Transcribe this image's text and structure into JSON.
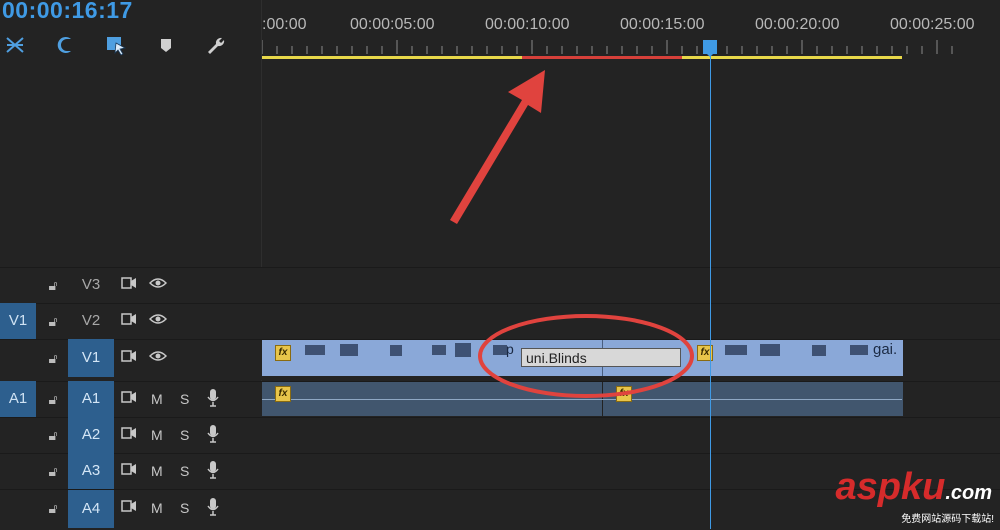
{
  "timecode": "00:00:16:17",
  "toolbar": {
    "icons": [
      "ripple-snap-icon",
      "snap-magnet-icon",
      "linked-selection-icon",
      "add-marker-icon",
      "settings-wrench-icon"
    ]
  },
  "ruler": {
    "labels": [
      ":00:00",
      "00:00:05:00",
      "00:00:10:00",
      "00:00:15:00",
      "00:00:20:00",
      "00:00:25:00"
    ],
    "work_area_color": "#e8d84a",
    "render_bar_color": "#d6403a"
  },
  "tracks": {
    "v3": {
      "label": "V3",
      "source": ""
    },
    "v2": {
      "label": "V2",
      "source": "V1"
    },
    "v1": {
      "label": "V1",
      "source": ""
    },
    "a1": {
      "label": "A1",
      "source": "A1",
      "m": "M",
      "s": "S"
    },
    "a2": {
      "label": "A2",
      "source": "",
      "m": "M",
      "s": "S"
    },
    "a3": {
      "label": "A3",
      "source": "",
      "m": "M",
      "s": "S"
    },
    "a4": {
      "label": "A4",
      "source": "",
      "m": "M",
      "s": "S"
    }
  },
  "clips": {
    "fx_label": "fx",
    "transition_label": "uni.Blinds",
    "clip_name_tail": "gai.",
    "clip_name_mid": "p"
  },
  "watermark": {
    "brand": "aspku",
    "suffix": ".com",
    "sub": "免费网站源码下载站!"
  },
  "colors": {
    "accent": "#3f9ae5",
    "video_clip": "#8aa8d8",
    "audio_clip": "#41566e",
    "annotation": "#e0433e"
  }
}
